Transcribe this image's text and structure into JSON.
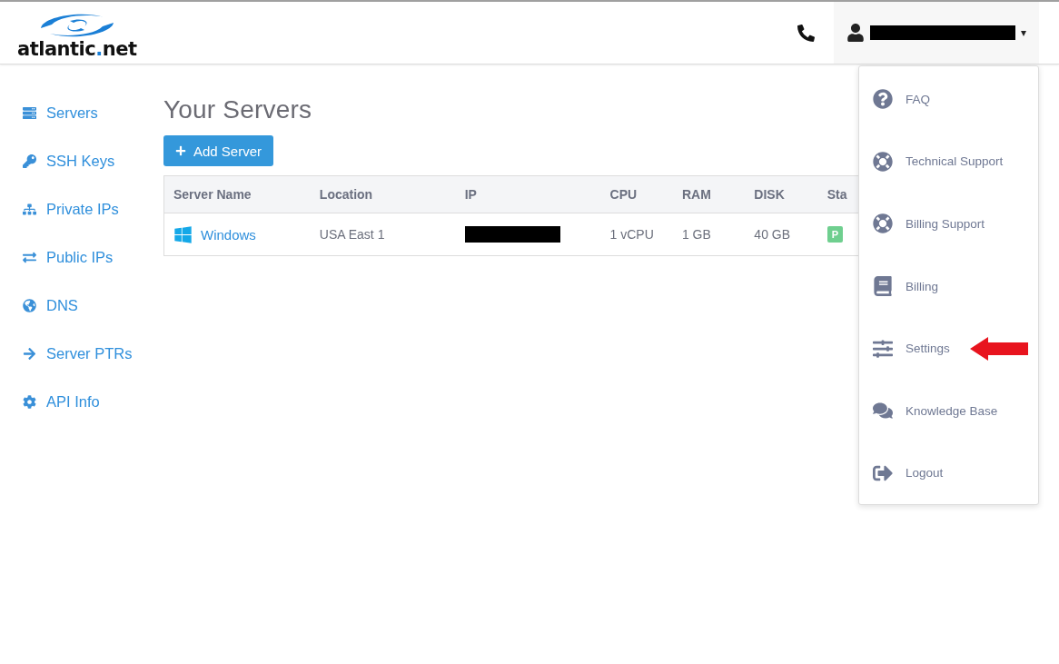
{
  "header": {
    "logo": {
      "parts": [
        {
          "text": "atlantic",
          "accent": false
        },
        {
          "text": ".",
          "accent": true
        },
        {
          "text": "net",
          "accent": false
        }
      ]
    },
    "user_menu": {
      "caret": "▾"
    }
  },
  "sidebar": {
    "items": [
      {
        "label": "Servers"
      },
      {
        "label": "SSH Keys"
      },
      {
        "label": "Private IPs"
      },
      {
        "label": "Public IPs"
      },
      {
        "label": "DNS"
      },
      {
        "label": "Server PTRs"
      },
      {
        "label": "API Info"
      }
    ]
  },
  "main": {
    "title": "Your Servers",
    "add_button": "Add Server",
    "table": {
      "columns": [
        "Server Name",
        "Location",
        "IP",
        "CPU",
        "RAM",
        "DISK",
        "Sta"
      ],
      "rows": [
        {
          "name": "Windows",
          "location": "USA East 1",
          "cpu": "1 vCPU",
          "ram": "1 GB",
          "disk": "40 GB",
          "status": "P",
          "color": "#6fcf8f"
        }
      ]
    }
  },
  "dropdown": {
    "items": [
      {
        "label": "FAQ",
        "annotated": false
      },
      {
        "label": "Technical Support",
        "annotated": false
      },
      {
        "label": "Billing Support",
        "annotated": false
      },
      {
        "label": "Billing",
        "annotated": false
      },
      {
        "label": "Settings",
        "annotated": true
      },
      {
        "label": "Knowledge Base",
        "annotated": false
      },
      {
        "label": "Logout",
        "annotated": false
      }
    ]
  }
}
